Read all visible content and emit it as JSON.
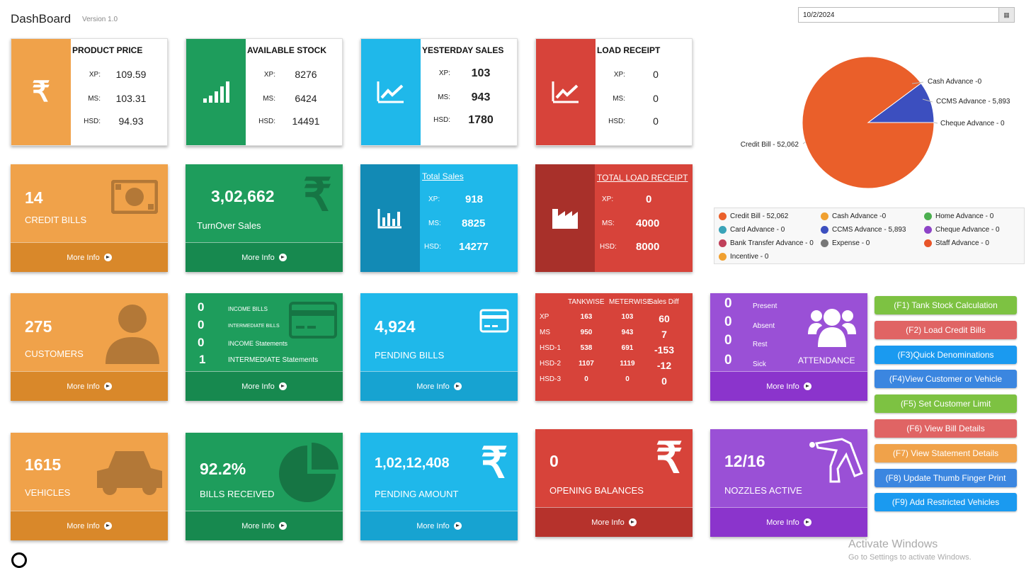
{
  "header": {
    "title": "DashBoard",
    "version": "Version 1.0",
    "date": "10/2/2024",
    "date_button_icon": "calendar-icon"
  },
  "product_price": {
    "title": "PRODUCT PRICE",
    "rows": [
      {
        "k": "XP:",
        "v": "109.59"
      },
      {
        "k": "MS:",
        "v": "103.31"
      },
      {
        "k": "HSD:",
        "v": "94.93"
      }
    ],
    "icon": "rupee-icon"
  },
  "available_stock": {
    "title": "AVAILABLE STOCK",
    "rows": [
      {
        "k": "XP:",
        "v": "8276"
      },
      {
        "k": "MS:",
        "v": "6424"
      },
      {
        "k": "HSD:",
        "v": "14491"
      }
    ],
    "icon": "signal-bars-icon"
  },
  "yesterday_sales": {
    "title": "YESTERDAY SALES",
    "rows": [
      {
        "k": "XP:",
        "v": "103"
      },
      {
        "k": "MS:",
        "v": "943"
      },
      {
        "k": "HSD:",
        "v": "1780"
      }
    ],
    "icon": "trend-up-icon"
  },
  "load_receipt": {
    "title": "LOAD RECEIPT",
    "rows": [
      {
        "k": "XP:",
        "v": "0"
      },
      {
        "k": "MS:",
        "v": "0"
      },
      {
        "k": "HSD:",
        "v": "0"
      }
    ],
    "icon": "trend-up-icon"
  },
  "credit_bills": {
    "value": "14",
    "label": "CREDIT BILLS",
    "more": "More Info"
  },
  "turnover": {
    "value": "3,02,662",
    "label": "TurnOver Sales",
    "more": "More Info"
  },
  "total_sales": {
    "title": "Total Sales",
    "rows": [
      {
        "k": "XP:",
        "v": "918"
      },
      {
        "k": "MS:",
        "v": "8825"
      },
      {
        "k": "HSD:",
        "v": "14277"
      }
    ]
  },
  "total_load_receipt": {
    "title": "TOTAL LOAD RECEIPT",
    "rows": [
      {
        "k": "XP:",
        "v": "0"
      },
      {
        "k": "MS:",
        "v": "4000"
      },
      {
        "k": "HSD:",
        "v": "8000"
      }
    ]
  },
  "customers": {
    "value": "275",
    "label": "CUSTOMERS",
    "more": "More Info"
  },
  "income": {
    "rows": [
      {
        "v": "0",
        "k": "INCOME BILLS"
      },
      {
        "v": "0",
        "k": "INTERMEDIATE BILLS"
      },
      {
        "v": "0",
        "k": "INCOME Statements"
      },
      {
        "v": "1",
        "k": "INTERMEDIATE Statements"
      }
    ],
    "more": "More Info"
  },
  "pending_bills": {
    "value": "4,924",
    "label": "PENDING BILLS",
    "more": "More Info"
  },
  "tankwise": {
    "headers": [
      "TANKWISE",
      "METERWISE",
      "Sales Diff"
    ],
    "rows": [
      [
        "XP",
        "163",
        "103",
        "60"
      ],
      [
        "MS",
        "950",
        "943",
        "7"
      ],
      [
        "HSD-1",
        "538",
        "691",
        "-153"
      ],
      [
        "HSD-2",
        "1107",
        "1119",
        "-12"
      ],
      [
        "HSD-3",
        "0",
        "0",
        "0"
      ]
    ]
  },
  "attendance": {
    "rows": [
      {
        "v": "0",
        "k": "Present"
      },
      {
        "v": "0",
        "k": "Absent"
      },
      {
        "v": "0",
        "k": "Rest"
      },
      {
        "v": "0",
        "k": "Sick"
      }
    ],
    "label": "ATTENDANCE",
    "more": "More Info"
  },
  "vehicles": {
    "value": "1615",
    "label": "VEHICLES",
    "more": "More Info"
  },
  "bills_received": {
    "value": "92.2%",
    "label": "BILLS RECEIVED",
    "more": "More Info"
  },
  "pending_amount": {
    "value": "1,02,12,408",
    "label": "PENDING AMOUNT",
    "more": "More Info"
  },
  "opening_balances": {
    "value": "0",
    "label": "OPENING BALANCES",
    "more": "More Info"
  },
  "nozzles": {
    "value": "12/16",
    "label": "NOZZLES ACTIVE",
    "more": "More Info"
  },
  "fkeys": [
    {
      "label": "(F1) Tank Stock Calculation",
      "color": "#7dc242"
    },
    {
      "label": "(F2) Load Credit Bills",
      "color": "#e06464"
    },
    {
      "label": "(F3)Quick Denominations",
      "color": "#1a9af0"
    },
    {
      "label": "(F4)View Customer or Vehicle",
      "color": "#3b86e0"
    },
    {
      "label": "(F5) Set Customer Limit",
      "color": "#7dc242"
    },
    {
      "label": "(F6) View Bill Details",
      "color": "#e06464"
    },
    {
      "label": "(F7) View Statement Details",
      "color": "#f0a24a"
    },
    {
      "label": "(F8) Update Thumb Finger Print",
      "color": "#3b86e0"
    },
    {
      "label": "(F9) Add Restricted Vehicles",
      "color": "#1a9af0"
    }
  ],
  "chart_data": {
    "type": "pie",
    "slices": [
      {
        "name": "Credit Bill - 52,062",
        "value": 52062,
        "color": "#ea5f2a"
      },
      {
        "name": "Cash Advance -0",
        "value": 0,
        "color": "#f0a030"
      },
      {
        "name": "CCMS Advance - 5,893",
        "value": 5893,
        "color": "#3c4fbf"
      },
      {
        "name": "Cheque Advance - 0",
        "value": 0,
        "color": "#8e44c7"
      }
    ],
    "legend": [
      {
        "name": "Credit Bill - 52,062",
        "color": "#ea5f2a"
      },
      {
        "name": "Cash Advance -0",
        "color": "#f0a030"
      },
      {
        "name": "Home Advance - 0",
        "color": "#4caf50"
      },
      {
        "name": "Card Advance - 0",
        "color": "#3aa3b8"
      },
      {
        "name": "CCMS Advance - 5,893",
        "color": "#3c4fbf"
      },
      {
        "name": "Cheque Advance - 0",
        "color": "#8e44c7"
      },
      {
        "name": "Bank Transfer Advance - 0",
        "color": "#c0405a"
      },
      {
        "name": "Expense - 0",
        "color": "#777777"
      },
      {
        "name": "Staff Advance - 0",
        "color": "#e8552a"
      },
      {
        "name": "Incentive - 0",
        "color": "#f0a030"
      }
    ]
  },
  "watermark": {
    "line1": "Activate Windows",
    "line2": "Go to Settings to activate Windows."
  }
}
